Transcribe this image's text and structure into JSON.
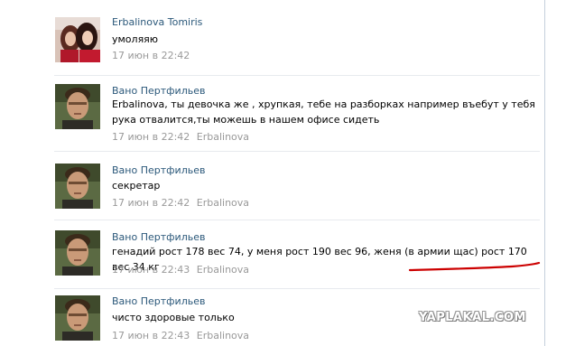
{
  "comments": [
    {
      "author": "Erbalinova Tomiris",
      "text": "умоляяю",
      "date": "17 июн в 22:42",
      "reply_to": ""
    },
    {
      "author": "Вано Пертфильев",
      "text": "Erbalinova, ты девочка же , хрупкая, тебе на разборках например въебут у тебя рука отвалится,ты можешь в нашем офисе сидеть",
      "date": "17 июн в 22:42",
      "reply_to": "Erbalinova"
    },
    {
      "author": "Вано Пертфильев",
      "text": "секретар",
      "date": "17 июн в 22:42",
      "reply_to": "Erbalinova"
    },
    {
      "author": "Вано Пертфильев",
      "text": "генадий рост 178 вес 74, у меня рост 190 вес 96, женя (в армии щас) рост 170 вес 34 кг",
      "date": "17 июн в 22:43",
      "reply_to": "Erbalinova"
    },
    {
      "author": "Вано Пертфильев",
      "text": "чисто здоровые только",
      "date": "17 июн в 22:43",
      "reply_to": "Erbalinova"
    }
  ],
  "watermark": "YAPLAKAL.COM",
  "colors": {
    "author_link": "#2b587a",
    "meta": "#999999",
    "divider": "#e7eaee",
    "annotation": "#cc0000"
  }
}
